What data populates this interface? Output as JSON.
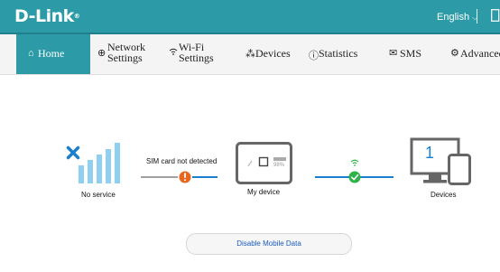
{
  "brand": {
    "logo_text": "D-Link",
    "registered_mark": "®"
  },
  "header": {
    "language_label": "English",
    "language_caret": "⌵"
  },
  "nav": {
    "home": "Home",
    "network_line1": "Network",
    "network_line2": "Settings",
    "wifi_line1": "Wi-Fi",
    "wifi_line2": "Settings",
    "devices": "Devices",
    "statistics": "Statistics",
    "sms": "SMS",
    "advanced": "Advanced"
  },
  "status": {
    "service_label": "No service",
    "sim_label": "SIM card not detected",
    "device_label": "My device",
    "battery_text": "98%",
    "device_count": "1",
    "devices_label": "Devices"
  },
  "actions": {
    "disable_mobile_data": "Disable Mobile Data"
  },
  "colors": {
    "header_bg": "#2c9ba7",
    "active_tab_bg": "#2c9ba7",
    "error_orange": "#e8671d",
    "ok_green": "#2fb24a",
    "link_blue": "#1a7fcf",
    "signal_bar": "#8fd0f2",
    "x_mark": "#1a7fcf"
  },
  "icons": {
    "home": "home-icon",
    "network": "globe-icon",
    "wifi": "wifi-icon",
    "devices": "devices-icon",
    "statistics": "statistics-icon",
    "sms": "envelope-icon",
    "advanced": "gear-icon"
  }
}
